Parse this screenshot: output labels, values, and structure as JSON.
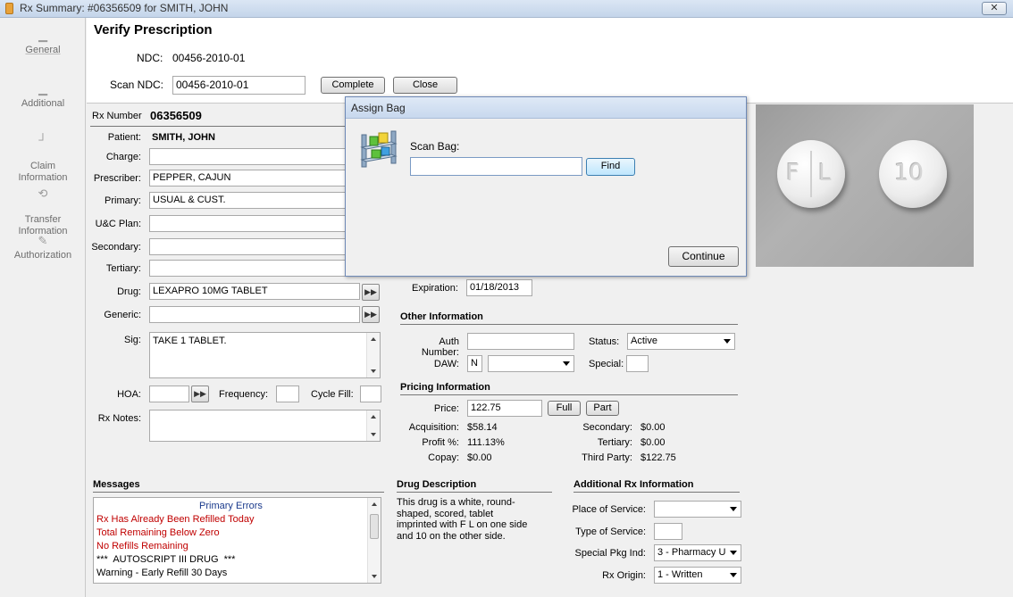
{
  "window": {
    "title": "Rx Summary: #06356509 for SMITH, JOHN",
    "close": "✕"
  },
  "sidebar": {
    "items": [
      {
        "label": "General",
        "icon": "document-icon"
      },
      {
        "label": "Additional",
        "icon": "additional-icon"
      },
      {
        "label": "Claim\nInformation",
        "icon": "claim-icon"
      },
      {
        "label": "Transfer\nInformation",
        "icon": "transfer-icon"
      },
      {
        "label": "Authorization",
        "icon": "pen-icon"
      }
    ]
  },
  "verify": {
    "title": "Verify Prescription",
    "ndc_label": "NDC:",
    "ndc_value": "00456-2010-01",
    "scan_ndc_label": "Scan NDC:",
    "scan_ndc_value": "00456-2010-01",
    "complete_label": "Complete",
    "close_label": "Close"
  },
  "rx": {
    "rx_number_label": "Rx Number",
    "rx_number": "06356509",
    "patient_label": "Patient:",
    "patient": "SMITH, JOHN",
    "charge_label": "Charge:",
    "charge": "",
    "prescriber_label": "Prescriber:",
    "prescriber": "PEPPER, CAJUN",
    "primary_label": "Primary:",
    "primary": "USUAL & CUST.",
    "uc_plan_label": "U&C Plan:",
    "uc_plan": "",
    "secondary_label": "Secondary:",
    "secondary": "",
    "tertiary_label": "Tertiary:",
    "tertiary": "",
    "drug_label": "Drug:",
    "drug": "LEXAPRO 10MG TABLET",
    "generic_label": "Generic:",
    "generic": "",
    "sig_label": "Sig:",
    "sig": "TAKE 1 TABLET.",
    "hoa_label": "HOA:",
    "frequency_label": "Frequency:",
    "cycle_fill_label": "Cycle Fill:",
    "rx_notes_label": "Rx Notes:",
    "expiration_label": "Expiration:",
    "expiration": "01/18/2013"
  },
  "other_info": {
    "title": "Other Information",
    "auth_number_label": "Auth Number:",
    "auth_number": "",
    "status_label": "Status:",
    "status": "Active",
    "daw_label": "DAW:",
    "daw": "N",
    "special_label": "Special:"
  },
  "pricing": {
    "title": "Pricing Information",
    "price_label": "Price:",
    "price": "122.75",
    "full_label": "Full",
    "part_label": "Part",
    "acquisition_label": "Acquisition:",
    "acquisition": "$58.14",
    "profit_label": "Profit %:",
    "profit": "111.13%",
    "copay_label": "Copay:",
    "copay": "$0.00",
    "secondary_label": "Secondary:",
    "secondary": "$0.00",
    "tertiary_label": "Tertiary:",
    "tertiary": "$0.00",
    "third_party_label": "Third Party:",
    "third_party": "$122.75"
  },
  "messages": {
    "title": "Messages",
    "header": "Primary Errors",
    "lines": [
      {
        "text": "Rx Has Already Been Refilled Today",
        "color": "red"
      },
      {
        "text": "Total Remaining Below Zero",
        "color": "red"
      },
      {
        "text": "No Refills Remaining",
        "color": "red"
      },
      {
        "text": "***  AUTOSCRIPT III DRUG  ***",
        "color": "black"
      },
      {
        "text": "Warning - Early Refill 30 Days",
        "color": "black"
      }
    ]
  },
  "drug_description": {
    "title": "Drug Description",
    "text": "This drug is a white, round-shaped, scored, tablet imprinted with F  L on one side and 10 on the other side."
  },
  "additional_rx": {
    "title": "Additional Rx Information",
    "place_of_service_label": "Place of Service:",
    "place_of_service": "",
    "type_of_service_label": "Type of Service:",
    "special_pkg_label": "Special Pkg Ind:",
    "special_pkg": "3 - Pharmacy U",
    "rx_origin_label": "Rx Origin:",
    "rx_origin": "1 - Written"
  },
  "dialog": {
    "title": "Assign Bag",
    "scan_bag_label": "Scan Bag:",
    "scan_bag_value": "",
    "find_label": "Find",
    "continue_label": "Continue"
  },
  "pill_image": {
    "left_mark_1": "F",
    "left_mark_2": "L",
    "right_mark": "10"
  }
}
